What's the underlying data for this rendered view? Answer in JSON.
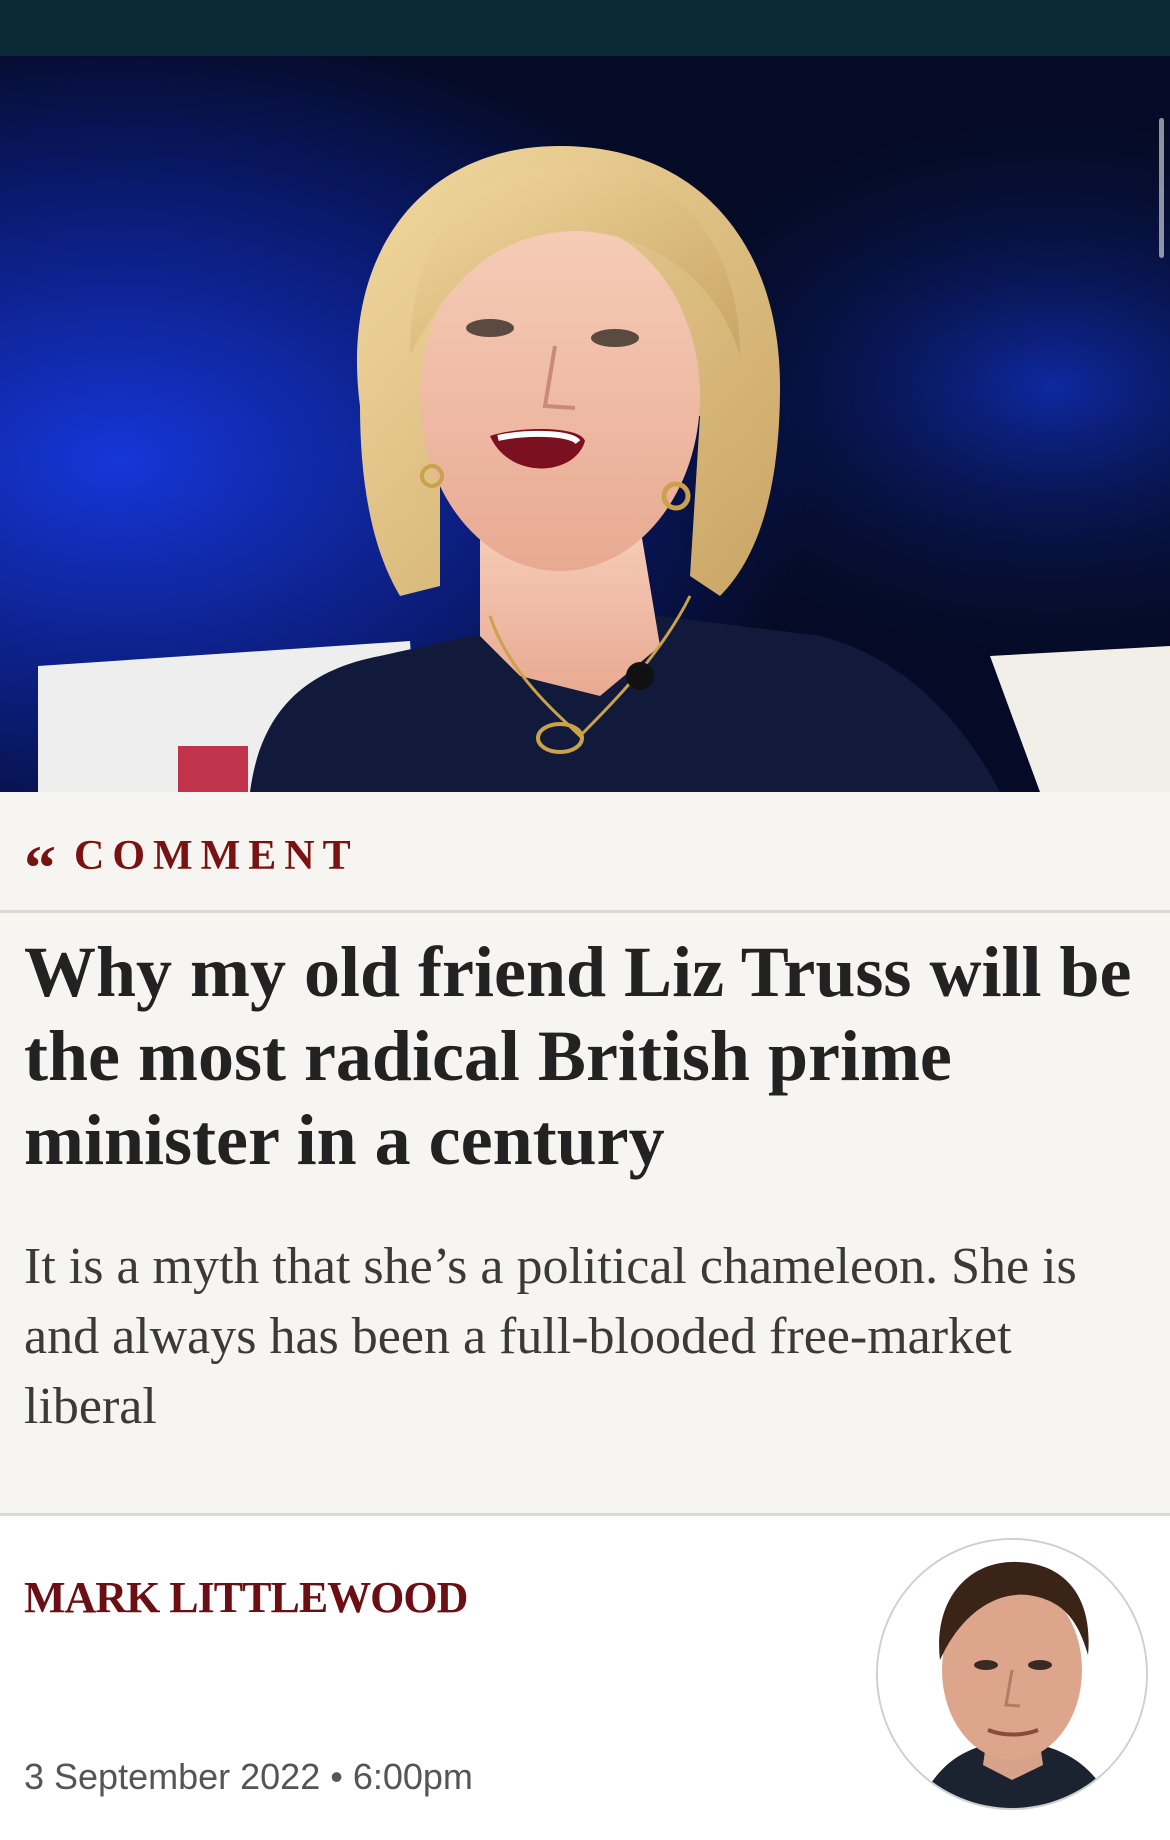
{
  "article": {
    "section": "COMMENT",
    "title": "Why my old friend Liz Truss will be the most radical British prime minister in a century",
    "standfirst": "It is a myth that she’s a political chameleon. She is and always has been a full-blooded free-market liberal",
    "author": "MARK LITTLEWOOD",
    "date": "3 September 2022 • 6:00pm"
  },
  "icons": {
    "section_icon": "quote-icon",
    "section_glyph": "“"
  },
  "colors": {
    "brand_dark": "#0b2a38",
    "accent_red": "#7a1212",
    "headline_bg": "#f7f5f1"
  }
}
